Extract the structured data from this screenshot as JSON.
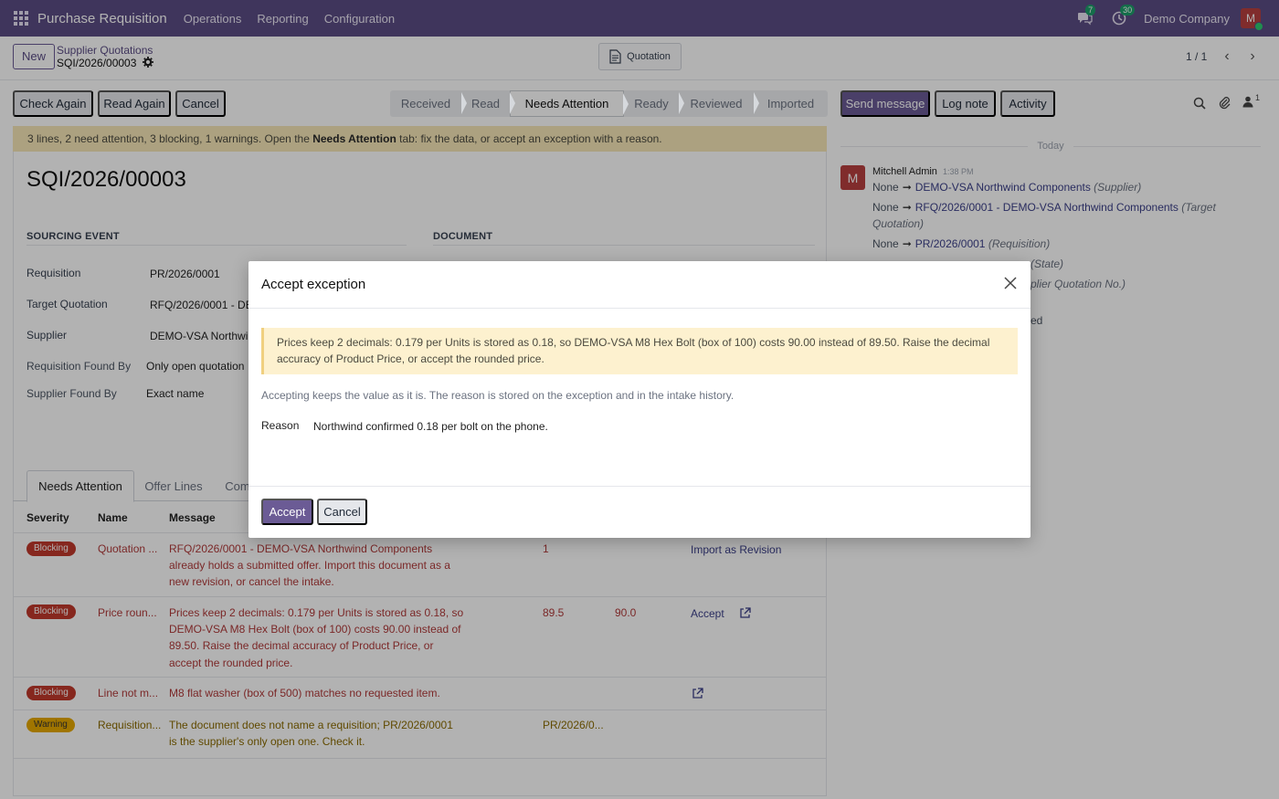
{
  "topbar": {
    "app_title": "Purchase Requisition",
    "menus": [
      "Operations",
      "Reporting",
      "Configuration"
    ],
    "messages_count": "7",
    "activities_count": "30",
    "company": "Demo Company",
    "user_initial": "M"
  },
  "control_panel": {
    "new_label": "New",
    "breadcrumb_parent": "Supplier Quotations",
    "breadcrumb_current": "SQI/2026/00003",
    "quotation_button": "Quotation",
    "pager": "1 / 1"
  },
  "actions": {
    "check_again": "Check Again",
    "read_again": "Read Again",
    "cancel": "Cancel"
  },
  "statusbar": [
    "Received",
    "Read",
    "Needs Attention",
    "Ready",
    "Reviewed",
    "Imported"
  ],
  "banner": {
    "before": "3 lines, 2 need attention, 3 blocking, 1 warnings. Open the ",
    "bold": "Needs Attention",
    "after": " tab: fix the data, or accept an exception with a reason."
  },
  "record": {
    "title": "SQI/2026/00003",
    "sections": {
      "sourcing": "SOURCING EVENT",
      "document": "DOCUMENT"
    },
    "fields": {
      "requisition_label": "Requisition",
      "requisition_value": "PR/2026/0001",
      "target_label": "Target Quotation",
      "target_value": "RFQ/2026/0001 - DE",
      "supplier_label": "Supplier",
      "supplier_value": "DEMO-VSA Northwi",
      "req_found_label": "Requisition Found By",
      "req_found_value": "Only open quotation",
      "sup_found_label": "Supplier Found By",
      "sup_found_value": "Exact name"
    }
  },
  "tabs": [
    "Needs Attention",
    "Offer Lines",
    "Com"
  ],
  "table": {
    "headers": {
      "severity": "Severity",
      "name": "Name",
      "message": "Message"
    },
    "rows": [
      {
        "severity": "Blocking",
        "name": "Quotation ...",
        "message_lines": [
          "RFQ/2026/0001 - DEMO-VSA Northwind Components",
          "already holds a submitted offer. Import this document as a",
          "new revision, or cancel the intake."
        ],
        "value": "1",
        "value2": "",
        "action": "Import as Revision"
      },
      {
        "severity": "Blocking",
        "name": "Price roun...",
        "message_lines": [
          "Prices keep 2 decimals: 0.179 per Units is stored as 0.18, so",
          "DEMO-VSA M8 Hex Bolt (box of 100) costs 90.00 instead of",
          "89.50. Raise the decimal accuracy of Product Price, or",
          "accept the rounded price."
        ],
        "value": "89.5",
        "value2": "90.0",
        "action": "Accept"
      },
      {
        "severity": "Blocking",
        "name": "Line not m...",
        "message_lines": [
          "M8 flat washer (box of 500) matches no requested item."
        ],
        "value": "",
        "value2": "",
        "action": ""
      },
      {
        "severity": "Warning",
        "name": "Requisition...",
        "message_lines": [
          "The document does not name a requisition; PR/2026/0001",
          "is the supplier's only open one. Check it."
        ],
        "value": "PR/2026/0...",
        "value2": "",
        "action": ""
      }
    ]
  },
  "chatter": {
    "send_message": "Send message",
    "log_note": "Log note",
    "activity": "Activity",
    "followers_count": "1",
    "today": "Today",
    "author": "Mitchell Admin",
    "time": "1:38 PM",
    "author_initial": "M",
    "changes": [
      {
        "old": "None",
        "new": "DEMO-VSA Northwind Components",
        "field": "(Supplier)"
      },
      {
        "old": "None",
        "new": "RFQ/2026/0001 - DEMO-VSA Northwind Components",
        "field": "(Target",
        "field_cont": "Quotation)"
      },
      {
        "old": "None",
        "new": "PR/2026/0001",
        "field": "(Requisition)"
      }
    ],
    "partial_state": "(State)",
    "partial_sqno": "plier Quotation No.)",
    "partial_ed": "ed"
  },
  "modal": {
    "title": "Accept exception",
    "alert_lines": [
      "Prices keep 2 decimals: 0.179 per Units is stored as 0.18, so DEMO-VSA M8 Hex Bolt (box of 100) costs 90.00 instead of 89.50. Raise the decimal",
      "accuracy of Product Price, or accept the rounded price."
    ],
    "note": "Accepting keeps the value as it is. The reason is stored on the exception and in the intake history.",
    "reason_label": "Reason",
    "reason_value": "Northwind confirmed 0.18 per bolt on the phone.",
    "accept": "Accept",
    "cancel": "Cancel"
  }
}
